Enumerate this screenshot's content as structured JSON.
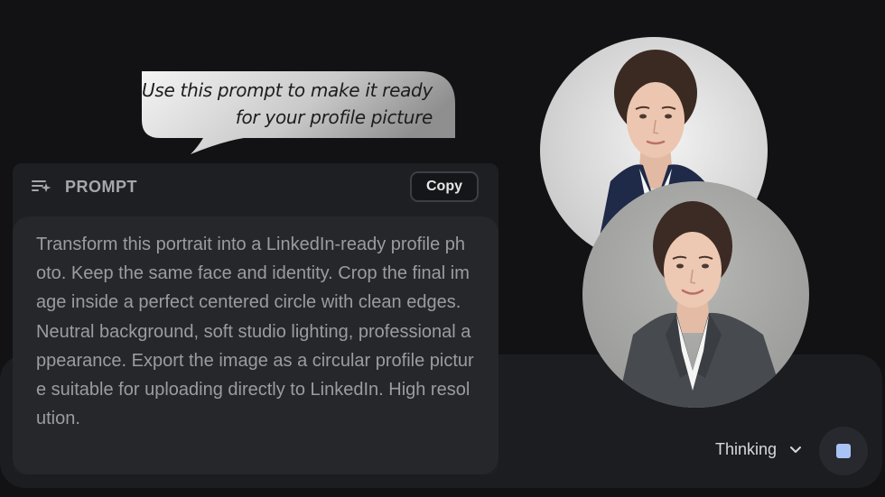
{
  "bubble": {
    "line1": "Use this prompt to make it ready",
    "line2": "for your profile picture"
  },
  "prompt": {
    "title": "PROMPT",
    "copy_label": "Copy",
    "icon": "prompt-sparkle-icon",
    "text": "Transform this portrait into a LinkedIn-ready profile photo. Keep the same face and identity. Crop the final image inside a perfect centered circle with clean edges. Neutral background, soft studio lighting, professional appearance. Export the image as a circular profile picture suitable for uploading directly to LinkedIn. High resolution."
  },
  "composer": {
    "mode_label": "Thinking",
    "mode_icon": "chevron-down-icon",
    "stop_icon": "stop-icon",
    "stop_color": "#a9c3f5"
  },
  "portraits": [
    {
      "name": "original-portrait",
      "background": "#dcdcdc"
    },
    {
      "name": "linkedin-portrait",
      "background": "#a9aaa8"
    }
  ]
}
